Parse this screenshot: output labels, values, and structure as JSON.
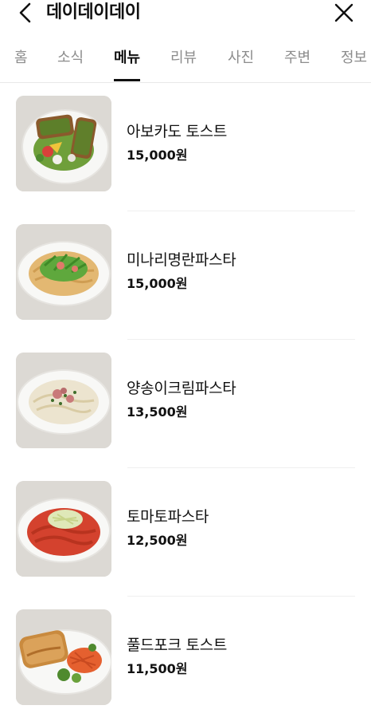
{
  "header": {
    "back_icon": "chevron-left-icon",
    "title": "데이데이데이",
    "close_icon": "close-icon"
  },
  "tabs": [
    {
      "label": "홈",
      "active": false
    },
    {
      "label": "소식",
      "active": false
    },
    {
      "label": "메뉴",
      "active": true
    },
    {
      "label": "리뷰",
      "active": false
    },
    {
      "label": "사진",
      "active": false
    },
    {
      "label": "주변",
      "active": false
    },
    {
      "label": "정보",
      "active": false
    }
  ],
  "menu": {
    "items": [
      {
        "name": "아보카도 토스트",
        "price": "15,000원",
        "image_icon": "avocado-toast-photo"
      },
      {
        "name": "미나리명란파스타",
        "price": "15,000원",
        "image_icon": "minari-pasta-photo"
      },
      {
        "name": "양송이크림파스타",
        "price": "13,500원",
        "image_icon": "cream-pasta-photo"
      },
      {
        "name": "토마토파스타",
        "price": "12,500원",
        "image_icon": "tomato-pasta-photo"
      },
      {
        "name": "풀드포크 토스트",
        "price": "11,500원",
        "image_icon": "pulled-pork-toast-photo"
      }
    ]
  },
  "colors": {
    "text": "#111111",
    "tab_inactive": "#8c8c8c",
    "divider": "#efefef"
  }
}
